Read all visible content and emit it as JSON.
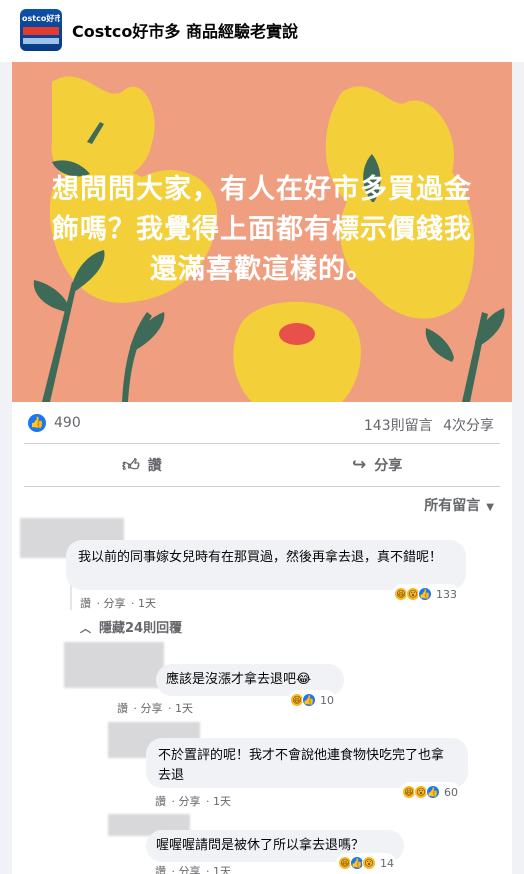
{
  "group": {
    "logo_text": "ostco好市",
    "title": "Costco好市多 商品經驗老實說"
  },
  "post": {
    "text": "想問問大家，有人在好市多買過金飾嗎？我覺得上面都有標示價錢我還滿喜歡這樣的。",
    "banner_colors": {
      "background": "#ef9f80",
      "flower": "#f3cf3a",
      "leaf": "#3e6b57",
      "accent": "#e8504a"
    },
    "likes": "490",
    "comments": "143則留言",
    "shares": "4次分享",
    "actions": {
      "like": "讚",
      "share": "分享"
    },
    "sort_label": "所有留言"
  },
  "comments": [
    {
      "text": "我以前的同事嫁女兒時有在那買過，然後再拿去退，真不錯呢！",
      "meta": {
        "like": "讚",
        "share": "分享",
        "time": "1天"
      },
      "reaction_count": "133",
      "reactions": [
        "haha",
        "wow",
        "like"
      ]
    }
  ],
  "hide_replies": "隱藏24則回覆",
  "replies": [
    {
      "text": "應該是沒漲才拿去退吧😂",
      "meta": {
        "like": "讚",
        "share": "分享",
        "time": "1天"
      },
      "reaction_count": "10",
      "reactions": [
        "haha",
        "like"
      ]
    },
    {
      "text": "不於置評的呢！我才不會說他連食物快吃完了也拿去退",
      "meta": {
        "like": "讚",
        "share": "分享",
        "time": "1天"
      },
      "reaction_count": "60",
      "reactions": [
        "haha",
        "wow",
        "like"
      ]
    },
    {
      "text": "喔喔喔請問是被休了所以拿去退嗎？",
      "meta": {
        "like": "讚",
        "share": "分享",
        "time": "1天"
      },
      "reaction_count": "14",
      "reactions": [
        "haha",
        "like",
        "wow"
      ]
    }
  ]
}
